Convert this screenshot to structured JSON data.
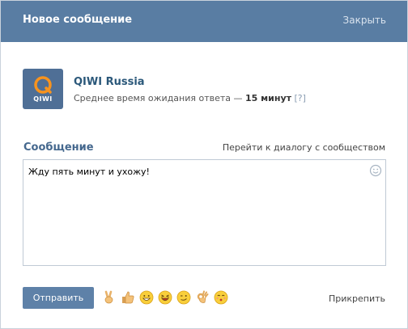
{
  "header": {
    "title": "Новое сообщение",
    "close_label": "Закрыть"
  },
  "community": {
    "logo_text": "QIWI",
    "name": "QIWI Russia",
    "wait_prefix": "Среднее время ожидания ответа — ",
    "wait_value": "15 минут",
    "help": "[?]"
  },
  "message": {
    "label": "Сообщение",
    "to_dialog_link": "Перейти к диалогу с сообществом",
    "text": "Жду пять минут и ухожу!"
  },
  "footer": {
    "send_label": "Отправить",
    "attach_label": "Прикрепить",
    "emojis": [
      "victory-hand",
      "thumbs-up",
      "grinning-face",
      "laughing-face",
      "winking-face",
      "ok-hand",
      "kissing-face"
    ]
  },
  "colors": {
    "header_bg": "#597da3",
    "accent": "#45688e",
    "button": "#5e81a8",
    "logo_orange": "#f7931e"
  }
}
